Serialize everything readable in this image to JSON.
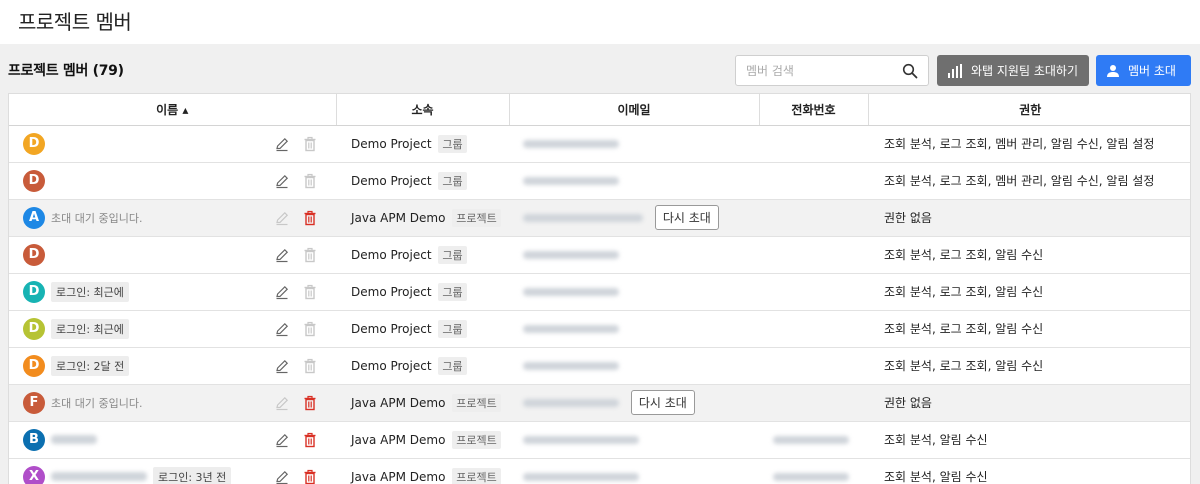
{
  "page": {
    "title": "프로젝트 멤버"
  },
  "toolbar": {
    "section_title": "프로젝트 멤버 (79)",
    "search_placeholder": "멤버 검색",
    "whatap_button": "와탭 지원팀 초대하기",
    "invite_button": "멤버 초대"
  },
  "table": {
    "columns": {
      "name": "이름 ▴",
      "org": "소속",
      "email": "이메일",
      "phone": "전화번호",
      "permission": "권한"
    },
    "rows": [
      {
        "initial": "D",
        "color": "#f2a623",
        "name": "",
        "login": "",
        "org": "Demo Project",
        "org_tag": "그룹",
        "email_blur": true,
        "reinvite": "",
        "phone_blur": false,
        "permission": "조회 분석, 로그 조회, 멤버 관리, 알림 수신, 알림 설정",
        "pending": false,
        "deletable": false
      },
      {
        "initial": "D",
        "color": "#c85b3a",
        "name": "",
        "login": "",
        "org": "Demo Project",
        "org_tag": "그룹",
        "email_blur": true,
        "reinvite": "",
        "phone_blur": false,
        "permission": "조회 분석, 로그 조회, 멤버 관리, 알림 수신, 알림 설정",
        "pending": false,
        "deletable": false
      },
      {
        "initial": "A",
        "color": "#1e88e5",
        "name": "초대 대기 중입니다.",
        "login": "",
        "org": "Java APM Demo",
        "org_tag": "프로젝트",
        "email_blur": true,
        "reinvite": "다시 초대",
        "phone_blur": false,
        "permission": "권한 없음",
        "pending": true,
        "deletable": true
      },
      {
        "initial": "D",
        "color": "#c85b3a",
        "name": "",
        "login": "",
        "org": "Demo Project",
        "org_tag": "그룹",
        "email_blur": true,
        "reinvite": "",
        "phone_blur": false,
        "permission": "조회 분석, 로그 조회, 알림 수신",
        "pending": false,
        "deletable": false
      },
      {
        "initial": "D",
        "color": "#17b3b3",
        "name": "",
        "login": "로그인: 최근에",
        "org": "Demo Project",
        "org_tag": "그룹",
        "email_blur": true,
        "reinvite": "",
        "phone_blur": false,
        "permission": "조회 분석, 로그 조회, 알림 수신",
        "pending": false,
        "deletable": false
      },
      {
        "initial": "D",
        "color": "#b6c334",
        "name": "",
        "login": "로그인: 최근에",
        "org": "Demo Project",
        "org_tag": "그룹",
        "email_blur": true,
        "reinvite": "",
        "phone_blur": false,
        "permission": "조회 분석, 로그 조회, 알림 수신",
        "pending": false,
        "deletable": false
      },
      {
        "initial": "D",
        "color": "#f28c1e",
        "name": "",
        "login": "로그인: 2달 전",
        "org": "Demo Project",
        "org_tag": "그룹",
        "email_blur": true,
        "reinvite": "",
        "phone_blur": false,
        "permission": "조회 분석, 로그 조회, 알림 수신",
        "pending": false,
        "deletable": false
      },
      {
        "initial": "F",
        "color": "#c85b3a",
        "name": "초대 대기 중입니다.",
        "login": "",
        "org": "Java APM Demo",
        "org_tag": "프로젝트",
        "email_blur": true,
        "reinvite": "다시 초대",
        "phone_blur": false,
        "permission": "권한 없음",
        "pending": true,
        "deletable": true
      },
      {
        "initial": "B",
        "color": "#0b6fb0",
        "name": "",
        "login": "",
        "org": "Java APM Demo",
        "org_tag": "프로젝트",
        "email_blur": true,
        "reinvite": "",
        "phone_blur": true,
        "permission": "조회 분석, 알림 수신",
        "pending": false,
        "deletable": true
      },
      {
        "initial": "X",
        "color": "#b04ec9",
        "name": "",
        "login": "로그인: 3년 전",
        "org": "Java APM Demo",
        "org_tag": "프로젝트",
        "email_blur": true,
        "reinvite": "",
        "phone_blur": true,
        "permission": "조회 분석, 알림 수신",
        "pending": false,
        "deletable": true
      }
    ]
  }
}
